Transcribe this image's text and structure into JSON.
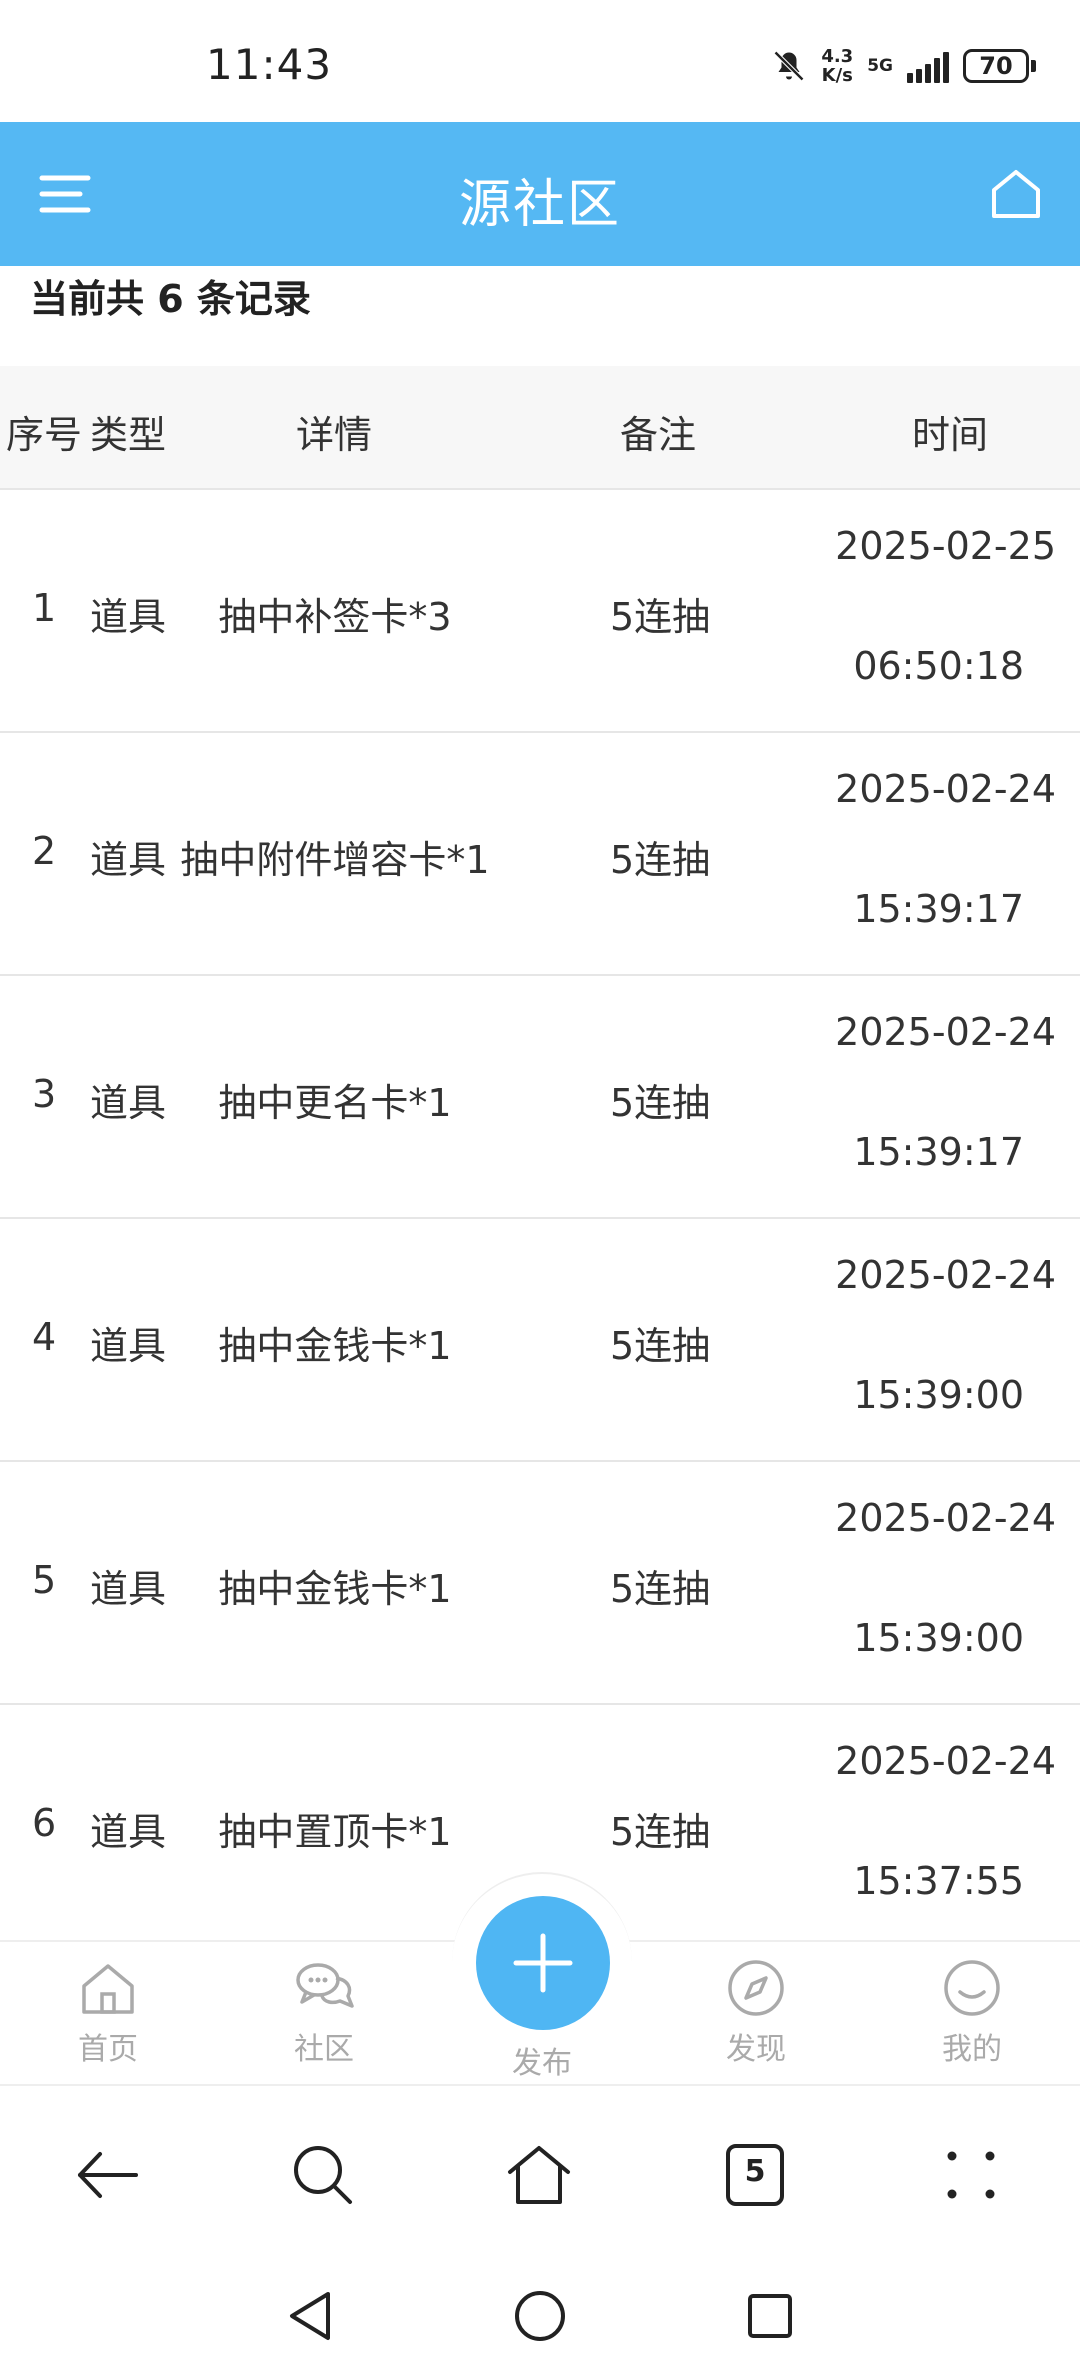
{
  "status_bar": {
    "time": "11:43",
    "net_speed_value": "4.3",
    "net_speed_unit": "K/s",
    "network": "5G",
    "battery": "70",
    "icons": [
      "bell-muted-icon",
      "signal-icon",
      "battery-icon"
    ]
  },
  "header": {
    "title": "源社区",
    "menu_icon": "menu-icon",
    "home_icon": "home-icon",
    "color": "#55b8f3"
  },
  "summary": {
    "count_text": "当前共 6 条记录"
  },
  "table": {
    "columns": [
      "序号",
      "类型",
      "详情",
      "备注",
      "时间"
    ],
    "rows": [
      {
        "seq": "1",
        "type": "道具",
        "detail": "抽中补签卡*3",
        "note": "5连抽",
        "date": "2025-02-25",
        "time": "06:50:18"
      },
      {
        "seq": "2",
        "type": "道具",
        "detail": "抽中附件增容卡*1",
        "note": "5连抽",
        "date": "2025-02-24",
        "time": "15:39:17"
      },
      {
        "seq": "3",
        "type": "道具",
        "detail": "抽中更名卡*1",
        "note": "5连抽",
        "date": "2025-02-24",
        "time": "15:39:17"
      },
      {
        "seq": "4",
        "type": "道具",
        "detail": "抽中金钱卡*1",
        "note": "5连抽",
        "date": "2025-02-24",
        "time": "15:39:00"
      },
      {
        "seq": "5",
        "type": "道具",
        "detail": "抽中金钱卡*1",
        "note": "5连抽",
        "date": "2025-02-24",
        "time": "15:39:00"
      },
      {
        "seq": "6",
        "type": "道具",
        "detail": "抽中置顶卡*1",
        "note": "5连抽",
        "date": "2025-02-24",
        "time": "15:37:55"
      }
    ]
  },
  "tab_bar": {
    "tabs": [
      {
        "label": "首页",
        "icon": "home-icon"
      },
      {
        "label": "社区",
        "icon": "chat-icon"
      },
      {
        "label": "发布",
        "icon": "plus-icon"
      },
      {
        "label": "发现",
        "icon": "compass-icon"
      },
      {
        "label": "我的",
        "icon": "smile-icon"
      }
    ],
    "accent": "#4fb6f3"
  },
  "browser_bar": {
    "icons": [
      "back-arrow-icon",
      "search-icon",
      "home-icon",
      "tabs-icon",
      "more-dots-icon"
    ],
    "tabs_count": "5"
  },
  "system_nav": {
    "icons": [
      "back-triangle-icon",
      "home-circle-icon",
      "recents-square-icon"
    ]
  }
}
